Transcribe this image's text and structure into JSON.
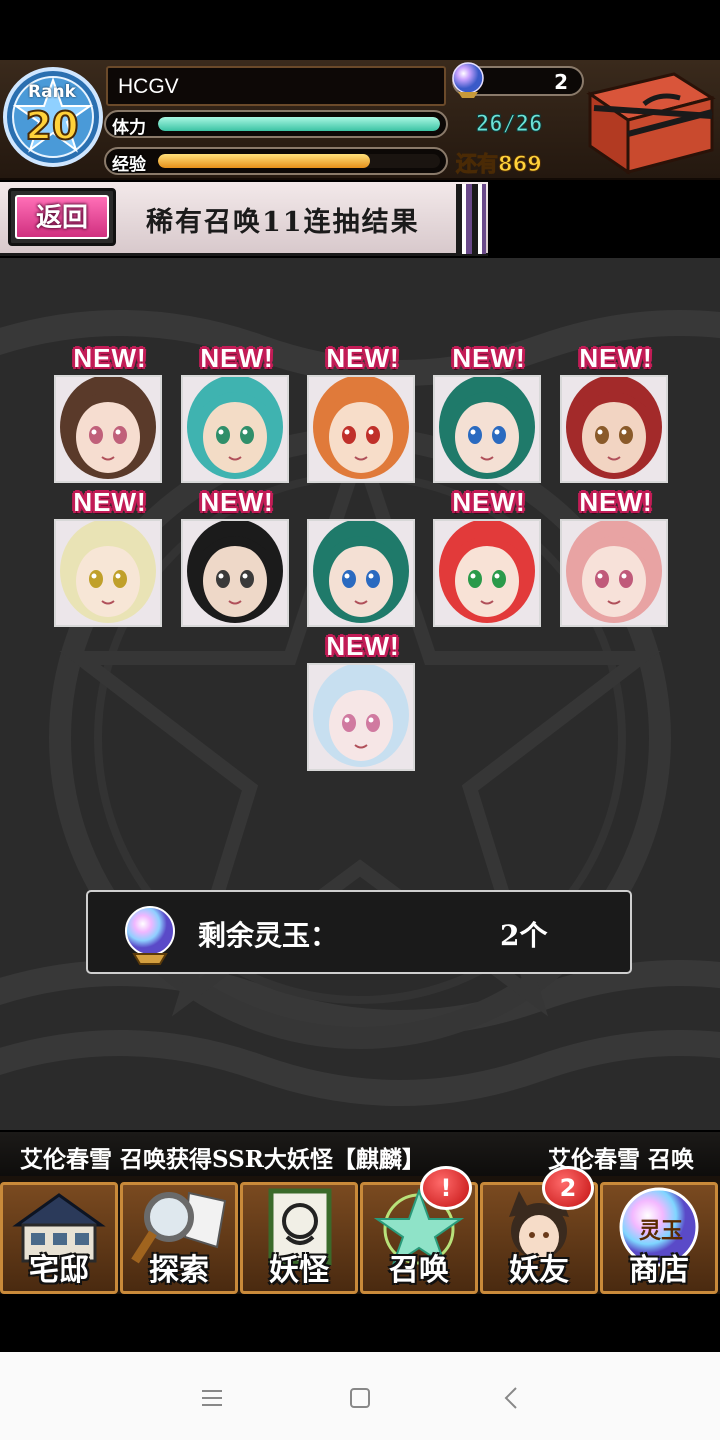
{
  "header": {
    "rank_label": "Rank",
    "rank_value": "20",
    "player_name": "HCGV",
    "gem_count": "2",
    "stamina_label": "体力",
    "stamina_text": "26/26",
    "stamina_fraction": 1.0,
    "exp_label": "经验",
    "exp_fraction": 0.75,
    "exp_remaining": "还有869"
  },
  "subheader": {
    "back_label": "返回",
    "title": "稀有召唤11连抽结果"
  },
  "results": {
    "new_label": "NEW!",
    "cards": [
      {
        "name": "result-card-1",
        "new": true,
        "hair": "#5a3a2a",
        "skin": "#f6ddd0",
        "eye": "#c0607a"
      },
      {
        "name": "result-card-2",
        "new": true,
        "hair": "#3fb3b0",
        "skin": "#f3dcc6",
        "eye": "#2f8f6a"
      },
      {
        "name": "result-card-3",
        "new": true,
        "hair": "#e07a3a",
        "skin": "#f7ddc9",
        "eye": "#c0302a"
      },
      {
        "name": "result-card-4",
        "new": true,
        "hair": "#1f7a6a",
        "skin": "#f4e0d4",
        "eye": "#2a6ac0"
      },
      {
        "name": "result-card-5",
        "new": true,
        "hair": "#a32a2a",
        "skin": "#f2d4c2",
        "eye": "#8a5a2a"
      },
      {
        "name": "result-card-6",
        "new": true,
        "hair": "#e9e3b5",
        "skin": "#f7e6d6",
        "eye": "#c0a02a"
      },
      {
        "name": "result-card-7",
        "new": true,
        "hair": "#1b1b1b",
        "skin": "#eed8c8",
        "eye": "#3a3a3a"
      },
      {
        "name": "result-card-8",
        "new": false,
        "hair": "#1f7a6a",
        "skin": "#f4e0d4",
        "eye": "#2a6ac0"
      },
      {
        "name": "result-card-9",
        "new": true,
        "hair": "#e23a3a",
        "skin": "#f8e2d6",
        "eye": "#2a9a4a"
      },
      {
        "name": "result-card-10",
        "new": true,
        "hair": "#e8a3a3",
        "skin": "#f7e1d9",
        "eye": "#c05a7a"
      },
      {
        "name": "result-card-11",
        "new": true,
        "hair": "#c7dff0",
        "skin": "#f6e6e6",
        "eye": "#d07aa0"
      }
    ],
    "remaining_label": "剩余灵玉：",
    "remaining_value": "2个"
  },
  "ticker": {
    "message": "艾伦春雪  召唤获得SSR大妖怪【麒麟】",
    "message_repeat": "艾伦春雪  召唤"
  },
  "nav": {
    "items": [
      {
        "label": "宅邸",
        "icon": "house-icon"
      },
      {
        "label": "探索",
        "icon": "magnifier-map-icon"
      },
      {
        "label": "妖怪",
        "icon": "scroll-demon-icon"
      },
      {
        "label": "召唤",
        "icon": "pentagram-icon",
        "badge": "!"
      },
      {
        "label": "妖友",
        "icon": "fox-girl-icon",
        "badge": "2"
      },
      {
        "label": "商店",
        "icon": "crystal-orb-icon",
        "orb_text": "灵玉"
      }
    ]
  },
  "colors": {
    "accent_pink": "#d0307f",
    "stamina": "#3bc3a4",
    "exp": "#e6901a",
    "badge_red": "#c21010"
  }
}
